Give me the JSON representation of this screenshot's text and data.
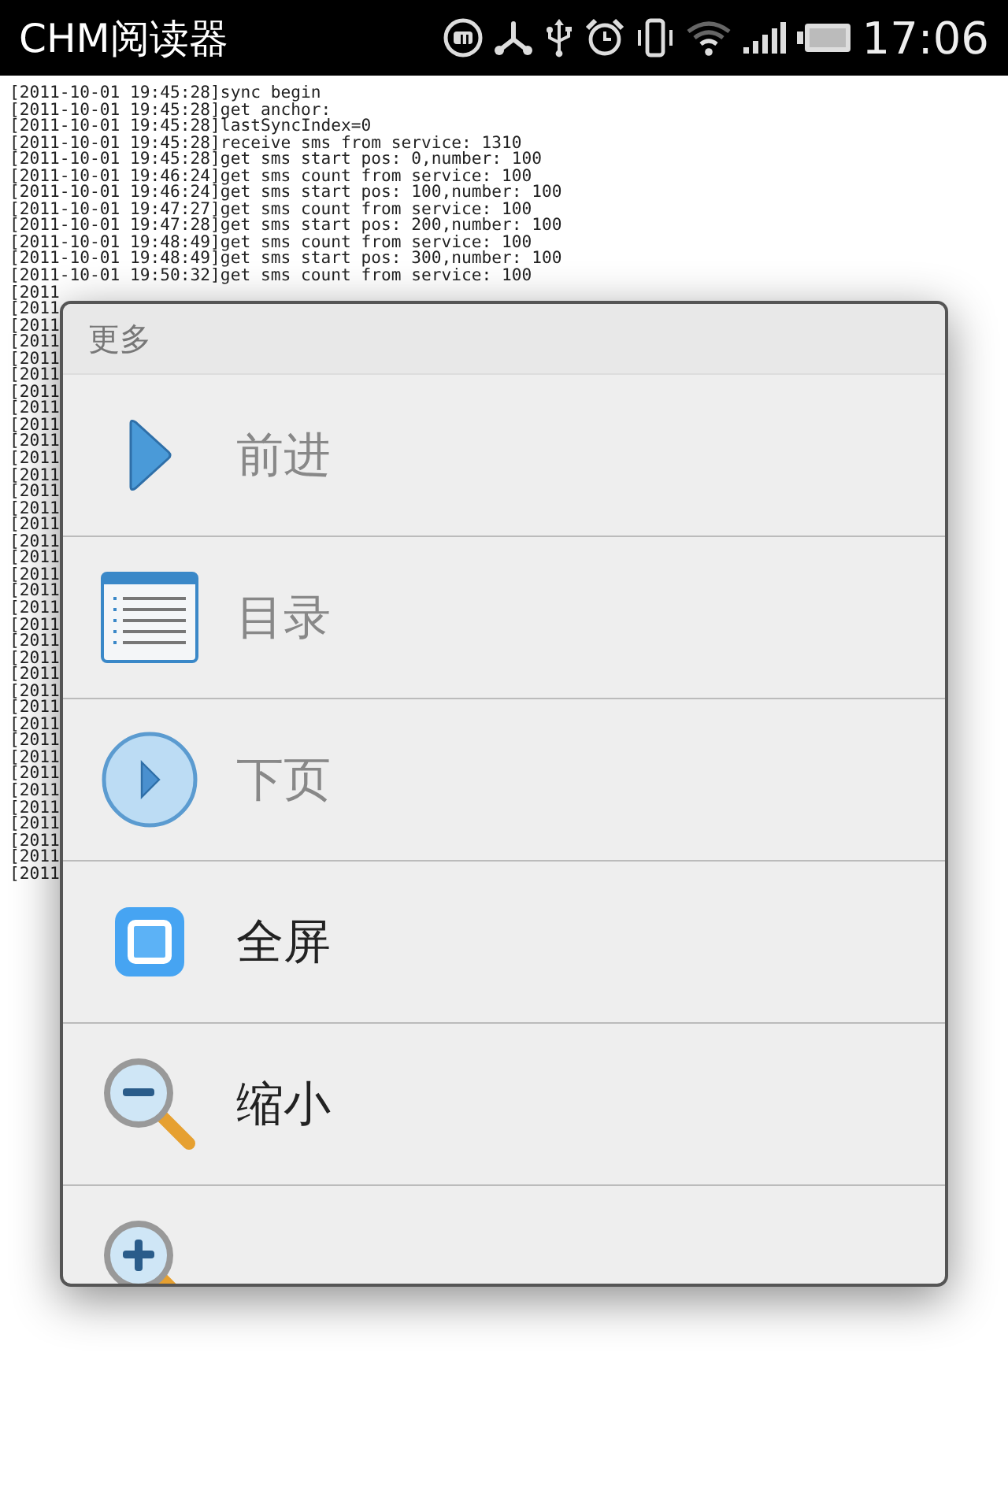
{
  "status_bar": {
    "app_title": "CHM阅读器",
    "time": "17:06"
  },
  "log": {
    "lines": [
      "[2011-10-01 19:45:28]sync begin",
      "[2011-10-01 19:45:28]get anchor:",
      "[2011-10-01 19:45:28]lastSyncIndex=0",
      "[2011-10-01 19:45:28]receive sms from service: 1310",
      "[2011-10-01 19:45:28]get sms start pos: 0,number: 100",
      "[2011-10-01 19:46:24]get sms count from service: 100",
      "[2011-10-01 19:46:24]get sms start pos: 100,number: 100",
      "[2011-10-01 19:47:27]get sms count from service: 100",
      "[2011-10-01 19:47:28]get sms start pos: 200,number: 100",
      "[2011-10-01 19:48:49]get sms count from service: 100",
      "[2011-10-01 19:48:49]get sms start pos: 300,number: 100",
      "[2011-10-01 19:50:32]get sms count from service: 100",
      "[2011",
      "[2011",
      "[2011",
      "[2011",
      "[2011",
      "[2011",
      "[2011",
      "[2011",
      "[2011",
      "[2011",
      "[2011",
      "[2011",
      "[2011",
      "[2011",
      "[2011",
      "[2011",
      "[2011",
      "[2011",
      "[2011",
      "[2011",
      "[2011",
      "[2011",
      "[2011",
      "[2011",
      "[2011",
      "[2011",
      "[2011",
      "[2011",
      "[2011",
      "[2011",
      "[2011",
      "[2011",
      "[2011",
      "[2011",
      "[2011",
      "[2011"
    ]
  },
  "menu": {
    "title": "更多",
    "items": [
      {
        "kind": "forward",
        "label": "前进",
        "disabled": true
      },
      {
        "kind": "contents",
        "label": "目录",
        "disabled": true
      },
      {
        "kind": "next-page",
        "label": "下页",
        "disabled": true
      },
      {
        "kind": "fullscreen",
        "label": "全屏",
        "disabled": false
      },
      {
        "kind": "zoom-out",
        "label": "缩小",
        "disabled": false
      },
      {
        "kind": "zoom-in"
      }
    ]
  }
}
